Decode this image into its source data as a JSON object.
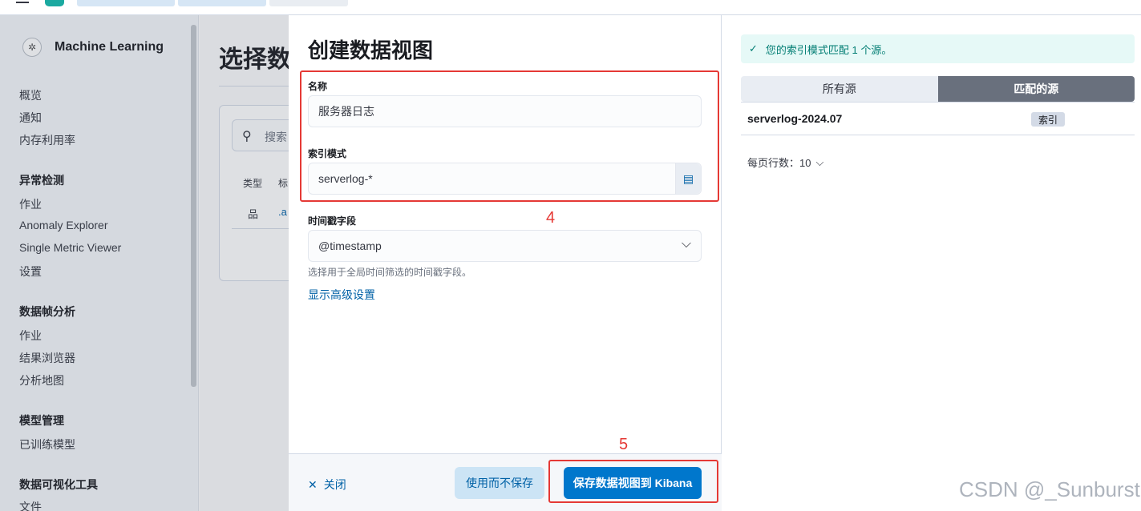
{
  "sidebar": {
    "app_title": "Machine Learning",
    "items": [
      {
        "label": "概览",
        "type": "item"
      },
      {
        "label": "通知",
        "type": "item"
      },
      {
        "label": "内存利用率",
        "type": "item"
      },
      {
        "label": "异常检测",
        "type": "head"
      },
      {
        "label": "作业",
        "type": "item"
      },
      {
        "label": "Anomaly Explorer",
        "type": "item"
      },
      {
        "label": "Single Metric Viewer",
        "type": "item"
      },
      {
        "label": "设置",
        "type": "item"
      },
      {
        "label": "数据帧分析",
        "type": "head"
      },
      {
        "label": "作业",
        "type": "item"
      },
      {
        "label": "结果浏览器",
        "type": "item"
      },
      {
        "label": "分析地图",
        "type": "item"
      },
      {
        "label": "模型管理",
        "type": "head"
      },
      {
        "label": "已训练模型",
        "type": "item"
      },
      {
        "label": "数据可视化工具",
        "type": "head"
      },
      {
        "label": "文件",
        "type": "item"
      }
    ]
  },
  "main": {
    "title_partial": "选择数",
    "search_placeholder": "搜索",
    "col_type": "类型",
    "col_name_partial": "标",
    "row_link_partial": ".a"
  },
  "flyout": {
    "title": "创建数据视图",
    "name_label": "名称",
    "name_value": "服务器日志",
    "index_label": "索引模式",
    "index_value": "serverlog-*",
    "timestamp_label": "时间戳字段",
    "timestamp_value": "@timestamp",
    "timestamp_help": "选择用于全局时间筛选的时间戳字段。",
    "advanced_link": "显示高级设置",
    "close_label": "关闭",
    "use_without_save": "使用而不保存",
    "save_to_kibana": "保存数据视图到 Kibana"
  },
  "annotations": {
    "step4": "4",
    "step5": "5",
    "color": "#e53935"
  },
  "preview": {
    "callout": "您的索引模式匹配 1 个源。",
    "tab_all": "所有源",
    "tab_matched": "匹配的源",
    "rows": [
      {
        "name": "serverlog-2024.07",
        "badge": "索引"
      }
    ],
    "rows_per_page": "每页行数：10"
  },
  "watermark": "CSDN @_Sunburst"
}
